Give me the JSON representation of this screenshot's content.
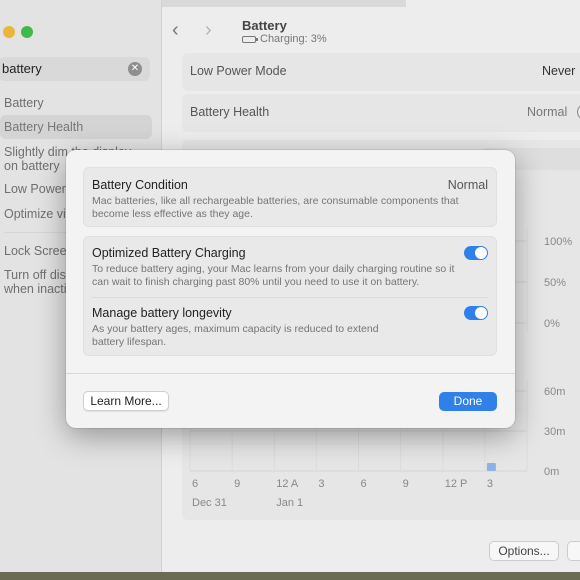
{
  "sidebar": {
    "search_value": "battery",
    "items": [
      {
        "label": "Battery"
      },
      {
        "label": "Battery Health"
      },
      {
        "label": "Slightly dim the display"
      },
      {
        "label": "on battery"
      },
      {
        "label": "Low Power"
      },
      {
        "label": "Optimize vi"
      },
      {
        "label": "Lock Scree"
      },
      {
        "label": "Turn off dis"
      },
      {
        "label": "when inacti"
      }
    ]
  },
  "header": {
    "title": "Battery",
    "status": "Charging: 3%"
  },
  "settings": {
    "low_power_label": "Low Power Mode",
    "low_power_value": "Never",
    "health_label": "Battery Health",
    "health_value": "Normal",
    "partial_tab": "s"
  },
  "chart_data": {
    "type": "bar",
    "y_top_ticks": [
      "100%",
      "50%",
      "0%"
    ],
    "y_bottom_ticks": [
      "60m",
      "30m",
      "0m"
    ],
    "x_ticks": [
      "6",
      "9",
      "12 A",
      "3",
      "6",
      "9",
      "12 P",
      "3"
    ],
    "date_labels": [
      "Dec 31",
      "Jan 1"
    ],
    "series": [
      {
        "values": [
          0,
          0,
          0,
          0,
          0,
          0,
          0,
          6
        ]
      }
    ],
    "ylim": [
      0,
      60
    ]
  },
  "modal": {
    "condition_title": "Battery Condition",
    "condition_value": "Normal",
    "condition_desc": "Mac batteries, like all rechargeable batteries, are consumable components that become less effective as they age.",
    "optimized_title": "Optimized Battery Charging",
    "optimized_desc": "To reduce battery aging, your Mac learns from your daily charging routine so it can wait to finish charging past 80% until you need to use it on battery.",
    "optimized_on": true,
    "longevity_title": "Manage battery longevity",
    "longevity_desc": "As your battery ages, maximum capacity is reduced to extend battery lifespan.",
    "longevity_on": true,
    "learn_more": "Learn More...",
    "done": "Done"
  },
  "footer": {
    "options": "Options..."
  },
  "colors": {
    "accent": "#2f80e8",
    "traffic_yellow": "#e8b73a",
    "traffic_green": "#3fb94a"
  }
}
